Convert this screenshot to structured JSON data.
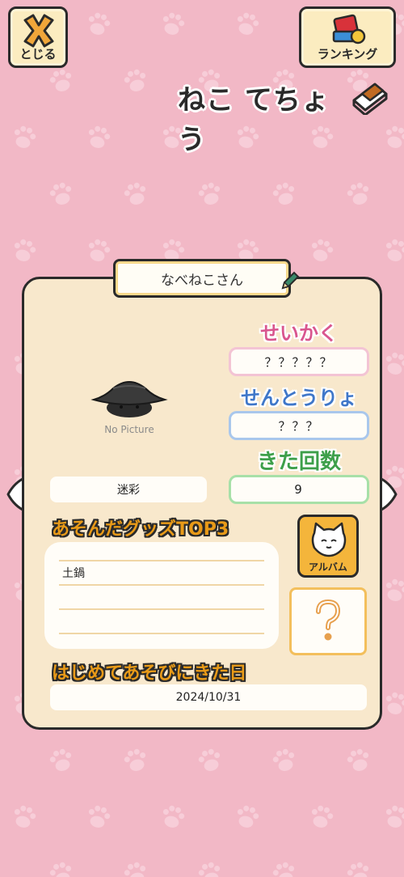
{
  "header": {
    "close_label": "とじる",
    "ranking_label": "ランキング",
    "title": "ねこ てちょう"
  },
  "cat": {
    "name": "なべねこさん",
    "picture_placeholder": "No Picture",
    "pattern": "迷彩",
    "personality_label": "せいかく",
    "personality_value": "？？？？？",
    "combat_label": "せんとうりょく",
    "combat_value": "？？？",
    "visits_label": "きた回数",
    "visits_value": "9"
  },
  "goods": {
    "heading": "あそんだグッズTOP3",
    "items": [
      "土鍋",
      "",
      ""
    ]
  },
  "album": {
    "label": "アルバム"
  },
  "first_visit": {
    "heading": "はじめてあそびにきた日",
    "date": "2024/10/31"
  },
  "colors": {
    "background": "#f2b8c6",
    "panel": "#f8e8cc",
    "personality_accent": "#d9568e",
    "combat_accent": "#3f77c9",
    "visits_accent": "#3d9f4a",
    "goods_accent": "#e89a18"
  },
  "icons": [
    "close-x-icon",
    "trophy-icon",
    "notebook-icon",
    "pencil-icon",
    "arrow-left-icon",
    "arrow-right-icon",
    "cat-face-icon",
    "question-icon"
  ]
}
